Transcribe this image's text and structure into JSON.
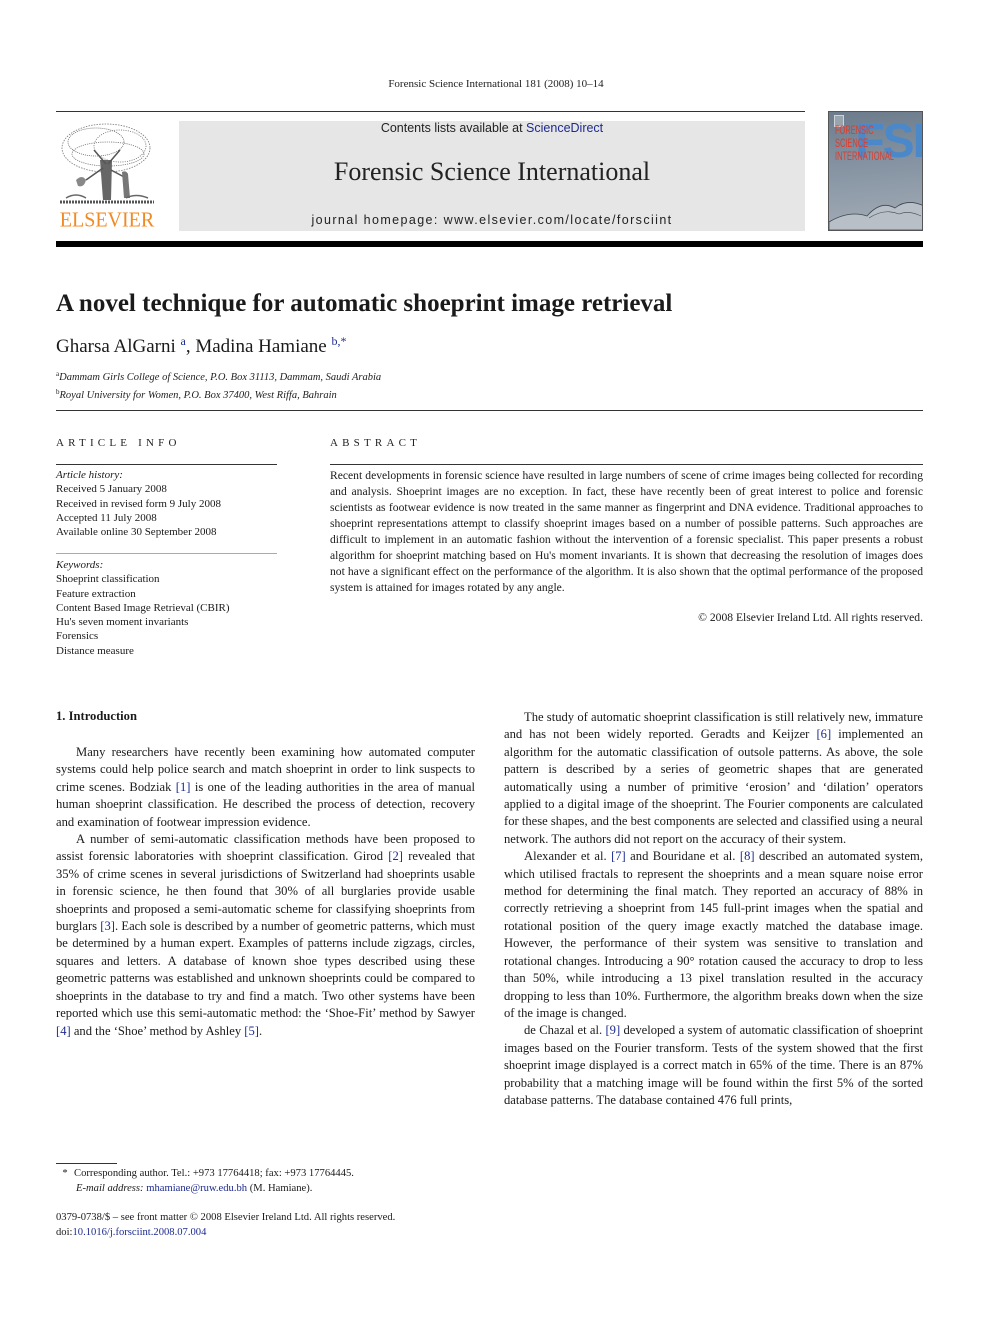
{
  "running_head": "Forensic Science International 181 (2008) 10–14",
  "header": {
    "publisher_logo_text": "ELSEVIER",
    "contents_prefix": "Contents lists available at ",
    "contents_link": "ScienceDirect",
    "journal_title": "Forensic Science International",
    "homepage_label": "journal homepage: www.elsevier.com/locate/forsciint",
    "cover": {
      "acronym": "FSI",
      "title_lines": [
        "FORENSIC",
        "SCIENCE",
        "INTERNATIONAL"
      ]
    },
    "colors": {
      "elsevier_orange": "#f08a24",
      "link_blue": "#1d2b8f",
      "banner_gray": "#e6e6e6",
      "cover_red": "#e23a2a",
      "cover_blue": "#4a88c9"
    }
  },
  "article": {
    "title": "A novel technique for automatic shoeprint image retrieval",
    "authors": [
      {
        "name": "Gharsa AlGarni",
        "marks": "a"
      },
      {
        "name": "Madina Hamiane",
        "marks": "b,*"
      }
    ],
    "author_separator": ", ",
    "affiliations": [
      {
        "mark": "a",
        "text": "Dammam Girls College of Science, P.O. Box 31113, Dammam, Saudi Arabia"
      },
      {
        "mark": "b",
        "text": "Royal University for Women, P.O. Box 37400, West Riffa, Bahrain"
      }
    ]
  },
  "article_info": {
    "heading": "ARTICLE INFO",
    "history_label": "Article history:",
    "history": [
      "Received 5 January 2008",
      "Received in revised form 9 July 2008",
      "Accepted 11 July 2008",
      "Available online 30 September 2008"
    ],
    "keywords_label": "Keywords:",
    "keywords": [
      "Shoeprint classification",
      "Feature extraction",
      "Content Based Image Retrieval (CBIR)",
      "Hu's seven moment invariants",
      "Forensics",
      "Distance measure"
    ]
  },
  "abstract": {
    "heading": "ABSTRACT",
    "text": "Recent developments in forensic science have resulted in large numbers of scene of crime images being collected for recording and analysis. Shoeprint images are no exception. In fact, these have recently been of great interest to police and forensic scientists as footwear evidence is now treated in the same manner as fingerprint and DNA evidence. Traditional approaches to shoeprint representations attempt to classify shoeprint images based on a number of possible patterns. Such approaches are difficult to implement in an automatic fashion without the intervention of a forensic specialist. This paper presents a robust algorithm for shoeprint matching based on Hu's moment invariants. It is shown that decreasing the resolution of images does not have a significant effect on the performance of the algorithm. It is also shown that the optimal performance of the proposed system is attained for images rotated by any angle.",
    "copyright": "© 2008 Elsevier Ireland Ltd. All rights reserved."
  },
  "body": {
    "section_heading": "1.  Introduction",
    "left_paragraphs": [
      [
        {
          "t": "Many researchers have recently been examining how automated computer systems could help police search and match shoeprint in order to link suspects to crime scenes. Bodziak "
        },
        {
          "ref": "[1]"
        },
        {
          "t": " is one of the leading authorities in the area of manual human shoeprint classification. He described the process of detection, recovery and examination of footwear impression evidence."
        }
      ],
      [
        {
          "t": "A number of semi-automatic classification methods have been proposed to assist forensic laboratories with shoeprint classification. Girod "
        },
        {
          "ref": "[2]"
        },
        {
          "t": " revealed that 35% of crime scenes in several jurisdictions of Switzerland had shoeprints usable in forensic science, he then found that 30% of all burglaries provide usable shoeprints and proposed a semi-automatic scheme for classifying shoeprints from burglars "
        },
        {
          "ref": "[3]"
        },
        {
          "t": ". Each sole is described by a number of geometric patterns, which must be determined by a human expert. Examples of patterns include zigzags, circles, squares and letters. A database of known shoe types described using these geometric patterns was established and unknown shoeprints could be compared to shoeprints in the database to try and find a match. Two other systems have been reported which use this semi-automatic method: the ‘Shoe-Fit’ method by Sawyer "
        },
        {
          "ref": "[4]"
        },
        {
          "t": " and the ‘Shoe’ method by Ashley "
        },
        {
          "ref": "[5]"
        },
        {
          "t": "."
        }
      ]
    ],
    "right_paragraphs": [
      [
        {
          "t": "The study of automatic shoeprint classification is still relatively new, immature and has not been widely reported. Geradts and Keijzer "
        },
        {
          "ref": "[6]"
        },
        {
          "t": " implemented an algorithm for the automatic classification of outsole patterns. As above, the sole pattern is described by a series of geometric shapes that are generated automatically using a number of primitive ‘erosion’ and ‘dilation’ operators applied to a digital image of the shoeprint. The Fourier components are calculated for these shapes, and the best components are selected and classified using a neural network. The authors did not report on the accuracy of their system."
        }
      ],
      [
        {
          "t": "Alexander et al. "
        },
        {
          "ref": "[7]"
        },
        {
          "t": " and Bouridane et al. "
        },
        {
          "ref": "[8]"
        },
        {
          "t": " described an automated system, which utilised fractals to represent the shoeprints and a mean square noise error method for determining the final match. They reported an accuracy of 88% in correctly retrieving a shoeprint from 145 full-print images when the spatial and rotational position of the query image exactly matched the database image. However, the performance of their system was sensitive to translation and rotational changes. Introducing a 90° rotation caused the accuracy to drop to less than 50%, while introducing a 13 pixel translation resulted in the accuracy dropping to less than 10%. Furthermore, the algorithm breaks down when the size of the image is changed."
        }
      ],
      [
        {
          "t": "de Chazal et al. "
        },
        {
          "ref": "[9]"
        },
        {
          "t": " developed a system of automatic classification of shoeprint images based on the Fourier transform. Tests of the system showed that the first shoeprint image displayed is a correct match in 65% of the time. There is an 87% probability that a matching image will be found within the first 5% of the sorted database patterns. The database contained 476 full prints,"
        }
      ]
    ]
  },
  "footnote": {
    "star": "*",
    "corresponding": "Corresponding author. Tel.: +973 17764418; fax: +973 17764445.",
    "email_label": "E-mail address:",
    "email": "mhamiane@ruw.edu.bh",
    "email_suffix": " (M. Hamiane)."
  },
  "front_matter": {
    "issn_line": "0379-0738/$ – see front matter © 2008 Elsevier Ireland Ltd. All rights reserved.",
    "doi_prefix": "doi:",
    "doi": "10.1016/j.forsciint.2008.07.004"
  }
}
